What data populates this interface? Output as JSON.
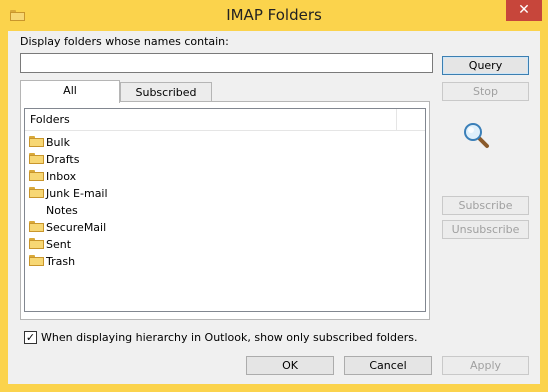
{
  "window": {
    "title": "IMAP Folders",
    "close_glyph": "✕"
  },
  "search": {
    "label": "Display folders whose names contain:",
    "value": ""
  },
  "buttons": {
    "query": "Query",
    "stop": "Stop",
    "subscribe": "Subscribe",
    "unsubscribe": "Unsubscribe",
    "ok": "OK",
    "cancel": "Cancel",
    "apply": "Apply"
  },
  "tabs": [
    {
      "label": "All",
      "active": true
    },
    {
      "label": "Subscribed",
      "active": false
    }
  ],
  "folders": {
    "column_header": "Folders",
    "items": [
      {
        "name": "Bulk",
        "icon": "folder-icon"
      },
      {
        "name": "Drafts",
        "icon": "folder-icon"
      },
      {
        "name": "Inbox",
        "icon": "folder-icon"
      },
      {
        "name": "Junk E-mail",
        "icon": "folder-icon"
      },
      {
        "name": "Notes",
        "icon": ""
      },
      {
        "name": "SecureMail",
        "icon": "folder-icon"
      },
      {
        "name": "Sent",
        "icon": "folder-icon"
      },
      {
        "name": "Trash",
        "icon": "folder-icon"
      }
    ]
  },
  "option": {
    "checked": true,
    "check_glyph": "✓",
    "label": "When displaying hierarchy in Outlook, show only subscribed folders."
  },
  "colors": {
    "titlebar": "#fbd34c",
    "close": "#c7463b",
    "dialog": "#f0f0f0"
  }
}
